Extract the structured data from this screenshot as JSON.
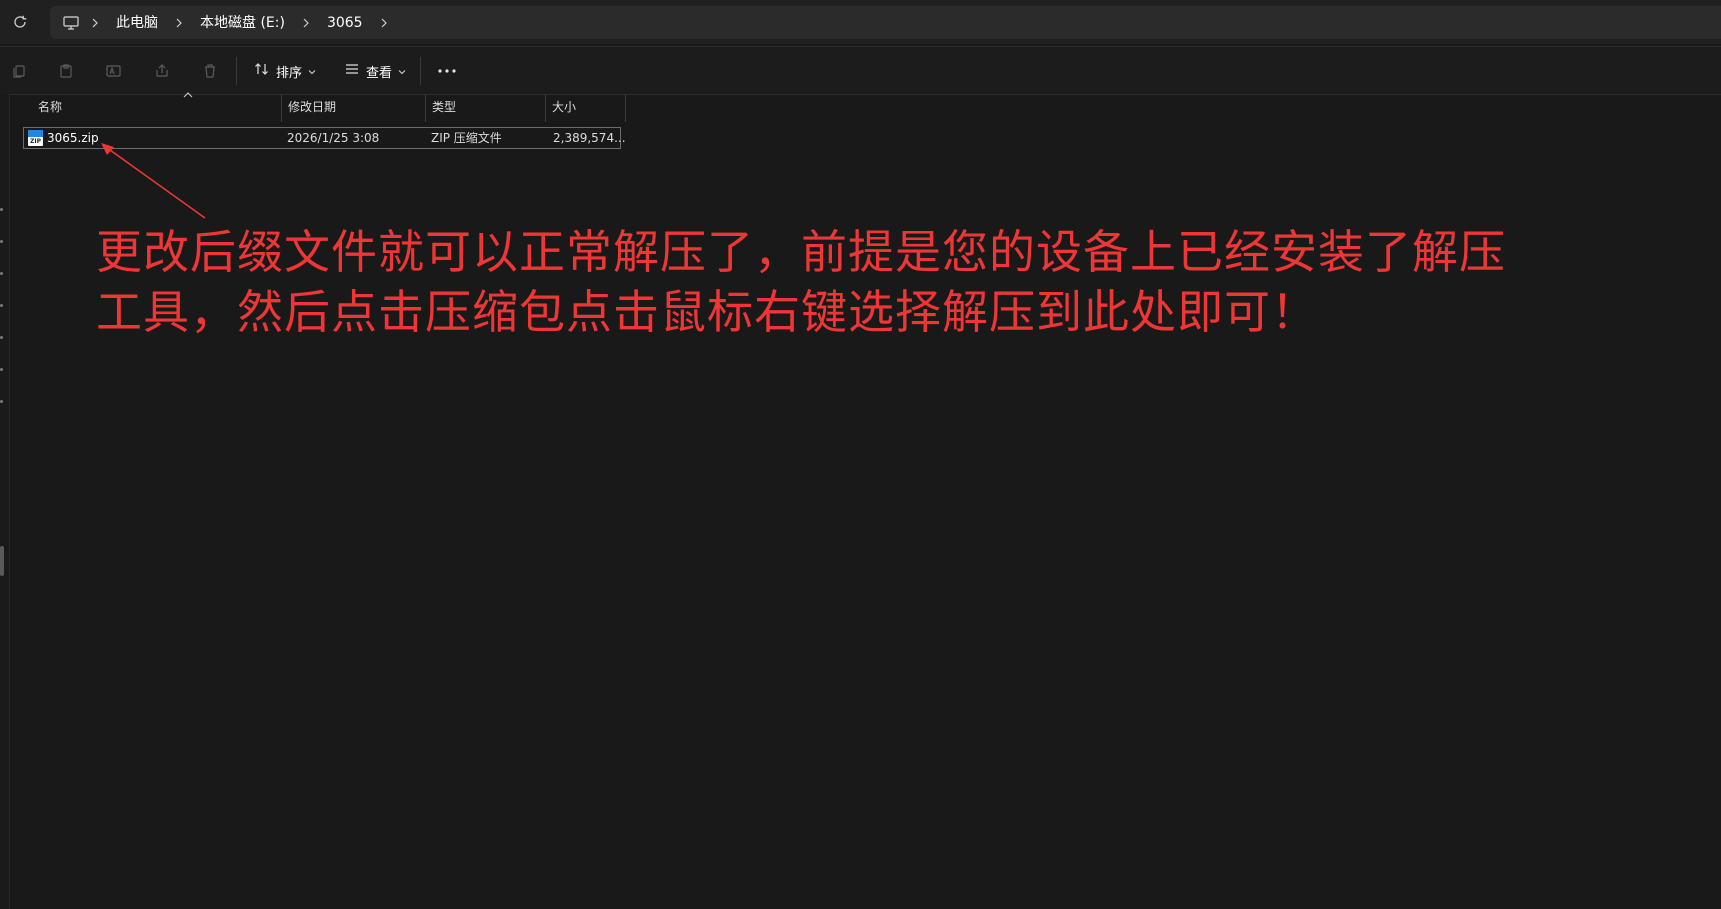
{
  "addressbar": {
    "breadcrumbs": [
      "此电脑",
      "本地磁盘 (E:)",
      "3065"
    ]
  },
  "toolbar": {
    "sort_label": "排序",
    "view_label": "查看"
  },
  "file_list": {
    "columns": [
      "名称",
      "修改日期",
      "类型",
      "大小"
    ],
    "rows": [
      {
        "name": "3065.zip",
        "modified": "2026/1/25 3:08",
        "type": "ZIP 压缩文件",
        "size": "2,389,574..."
      }
    ]
  },
  "annotation": {
    "line1": "更改后缀文件就可以正常解压了，前提是您的设备上已经安装了解压",
    "line2": "工具，然后点击压缩包点击鼠标右键选择解压到此处即可！",
    "color": "#ef3636"
  },
  "icons": {
    "zip_badge": "ZIP"
  }
}
